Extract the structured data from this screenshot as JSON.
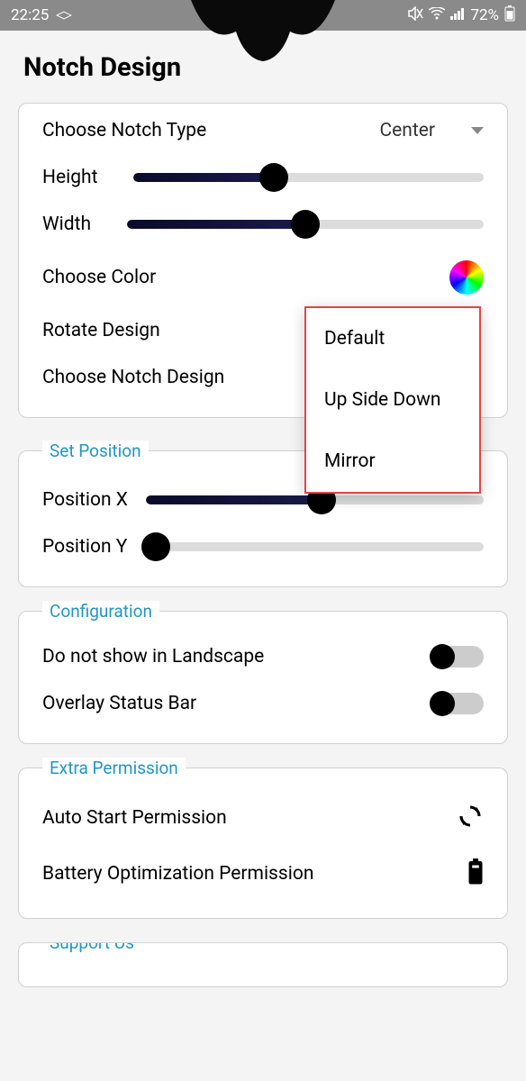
{
  "status_bar": {
    "time": "22:25",
    "battery": "72%"
  },
  "header": {
    "title": "Notch Design"
  },
  "notch_section": {
    "choose_type_label": "Choose Notch Type",
    "choose_type_value": "Center",
    "height_label": "Height",
    "height_value": 40,
    "width_label": "Width",
    "width_value": 50,
    "choose_color_label": "Choose Color",
    "rotate_label": "Rotate Design",
    "choose_design_label": "Choose Notch Design"
  },
  "rotate_popup": {
    "items": [
      {
        "label": "Default"
      },
      {
        "label": "Up Side Down"
      },
      {
        "label": "Mirror"
      }
    ]
  },
  "position_section": {
    "title": "Set Position",
    "x_label": "Position X",
    "x_value": 52,
    "y_label": "Position Y",
    "y_value": 3
  },
  "config_section": {
    "title": "Configuration",
    "landscape_label": "Do not show in Landscape",
    "landscape_on": false,
    "overlay_label": "Overlay Status Bar",
    "overlay_on": false
  },
  "permission_section": {
    "title": "Extra Permission",
    "auto_start_label": "Auto Start Permission",
    "battery_opt_label": "Battery Optimization Permission"
  },
  "support_section": {
    "title": "Support Us"
  }
}
